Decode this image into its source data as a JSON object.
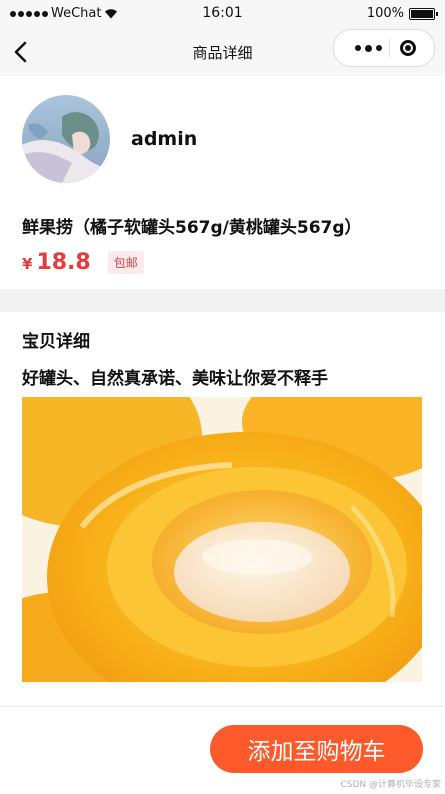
{
  "status_bar": {
    "carrier": "WeChat",
    "time": "16:01",
    "battery": "100%"
  },
  "nav": {
    "title": "商品详细"
  },
  "seller": {
    "name": "admin"
  },
  "product": {
    "title": "鲜果捞（橘子软罐头567g/黄桃罐头567g）",
    "price_symbol": "¥",
    "price": "18.8",
    "shipping_badge": "包邮"
  },
  "details": {
    "section_title": "宝贝详细",
    "description": "好罐头、自然真承诺、美味让你爱不释手"
  },
  "footer": {
    "add_to_cart_label": "添加至购物车",
    "watermark": "CSDN @计算机毕设专家"
  },
  "colors": {
    "accent": "#fc5a2a",
    "price": "#e73b3b",
    "badge_bg": "#fdeaea"
  }
}
